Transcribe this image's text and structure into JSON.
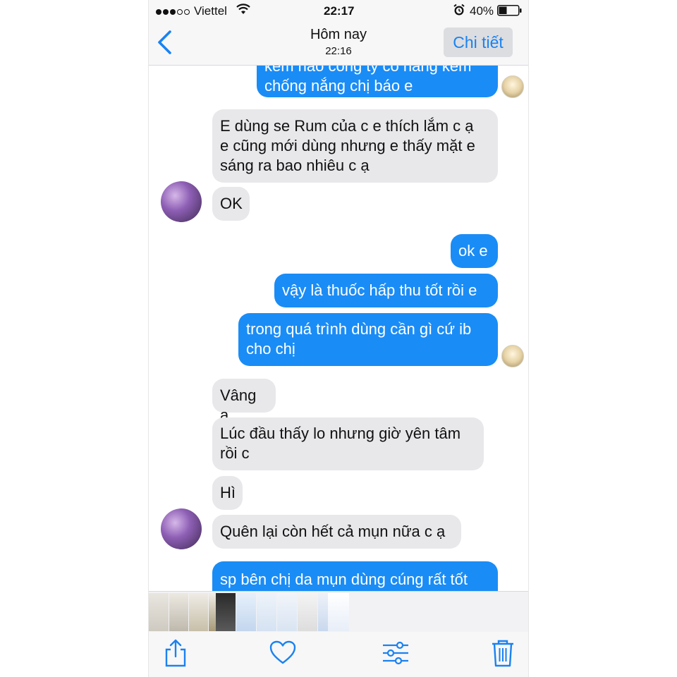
{
  "status_bar": {
    "carrier": "Viettel",
    "time": "22:17",
    "battery": "40%"
  },
  "nav": {
    "title": "Hôm nay",
    "subtitle": "22:16",
    "details_label": "Chi tiết"
  },
  "messages": [
    {
      "side": "out",
      "text": "kem nào công ty có hàng kem\nchống nắng chị báo e"
    },
    {
      "side": "in",
      "text": "E dùng se Rum của c e thích lắm c ạ\ne cũng mới dùng nhưng e thấy mặt e\nsáng ra bao nhiêu c ạ"
    },
    {
      "side": "in",
      "text": "OK"
    },
    {
      "side": "out",
      "text": "ok e"
    },
    {
      "side": "out",
      "text": "vậy là thuốc hấp thu tốt rồi e"
    },
    {
      "side": "out",
      "text": "trong quá trình dùng cần gì cứ ib\ncho chị"
    },
    {
      "side": "in",
      "text": "Vâng ạ"
    },
    {
      "side": "in",
      "text": "Lúc đầu thấy lo nhưng giờ yên tâm\nrồi c"
    },
    {
      "side": "in",
      "text": "Hì"
    },
    {
      "side": "in",
      "text": "Quên lại còn hết cả mụn nữa c ạ"
    },
    {
      "side": "out",
      "text": "sp bên chị da mụn dùng cúng rất tốt"
    }
  ],
  "colors": {
    "outgoing_bubble": "#1a8cf6",
    "incoming_bubble": "#e8e8eb",
    "accent": "#1a82f0"
  },
  "toolbar": {
    "icons": [
      "share-icon",
      "heart-icon",
      "adjust-icon",
      "trash-icon"
    ]
  }
}
